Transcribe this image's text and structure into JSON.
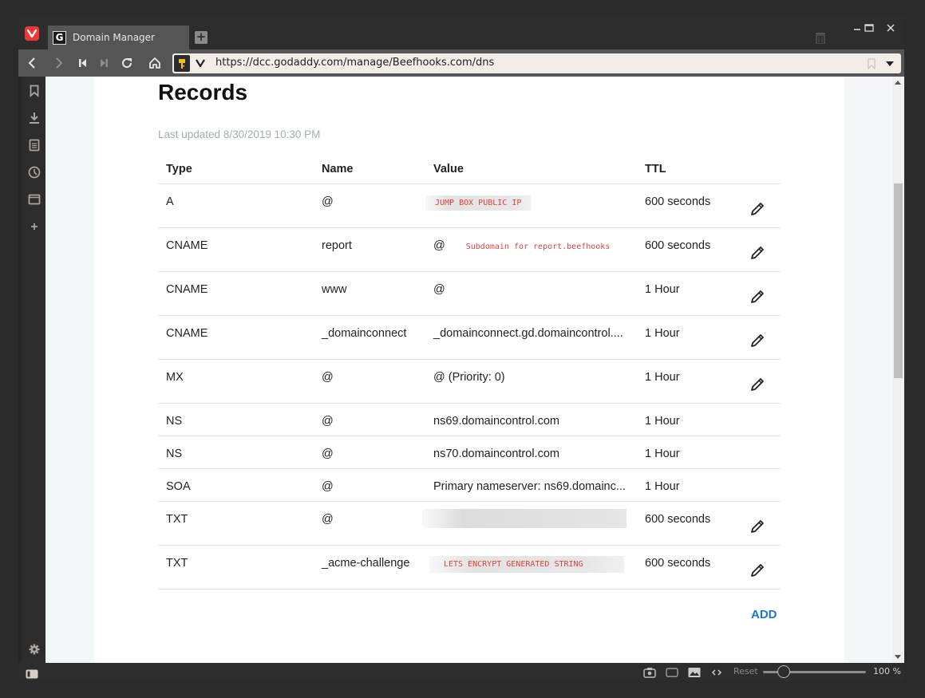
{
  "browser": {
    "tab_title": "Domain Manager",
    "tab_favicon": "G",
    "url": "https://dcc.godaddy.com/manage/Beefhooks.com/dns",
    "zoom_reset_label": "Reset",
    "zoom_level": "100 %",
    "zoom_fraction": 0.2
  },
  "page": {
    "title": "Records",
    "last_updated": "Last updated 8/30/2019 10:30 PM",
    "columns": [
      "Type",
      "Name",
      "Value",
      "TTL"
    ],
    "add_label": "ADD",
    "records": [
      {
        "type": "A",
        "name": "@",
        "value": "",
        "redaction_note": "JUMP BOX PUBLIC IP",
        "ttl": "600 seconds",
        "editable": true
      },
      {
        "type": "CNAME",
        "name": "report",
        "value": "@",
        "annotation": "Subdomain for report.beefhooks",
        "ttl": "600 seconds",
        "editable": true
      },
      {
        "type": "CNAME",
        "name": "www",
        "value": "@",
        "ttl": "1 Hour",
        "editable": true
      },
      {
        "type": "CNAME",
        "name": "_domainconnect",
        "value": "_domainconnect.gd.domaincontrol....",
        "ttl": "1 Hour",
        "editable": true
      },
      {
        "type": "MX",
        "name": "@",
        "value": "@ (Priority: 0)",
        "ttl": "1 Hour",
        "editable": true
      },
      {
        "type": "NS",
        "name": "@",
        "value": "ns69.domaincontrol.com",
        "ttl": "1 Hour",
        "editable": false
      },
      {
        "type": "NS",
        "name": "@",
        "value": "ns70.domaincontrol.com",
        "ttl": "1 Hour",
        "editable": false
      },
      {
        "type": "SOA",
        "name": "@",
        "value": "Primary nameserver: ns69.domainc...",
        "ttl": "1 Hour",
        "editable": false
      },
      {
        "type": "TXT",
        "name": "@",
        "value": "",
        "redacted": true,
        "ttl": "600 seconds",
        "editable": true
      },
      {
        "type": "TXT",
        "name": "_acme-challenge",
        "value": "",
        "redaction_note": "LETS ENCRYPT GENERATED STRING",
        "ttl": "600 seconds",
        "editable": true
      }
    ]
  },
  "colors": {
    "accent": "#1976d2",
    "annotation_red": "#e04040",
    "vivaldi_red": "#ef3939"
  }
}
